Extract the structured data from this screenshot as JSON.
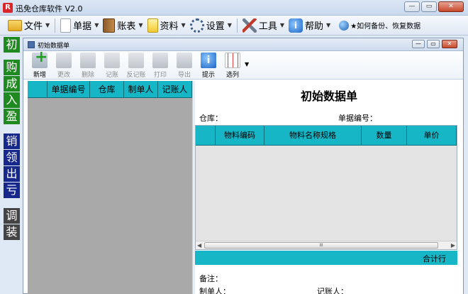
{
  "app": {
    "logo": "R",
    "title": "迅免仓库软件 V2.0"
  },
  "menu": {
    "file": "文件",
    "bill": "单据",
    "ledger": "账表",
    "info": "资料",
    "settings": "设置",
    "tools": "工具",
    "help": "帮助",
    "backup": "★如何备份、恢复数据"
  },
  "left_nav": [
    "初",
    "购",
    "成",
    "入",
    "盈",
    "销",
    "领",
    "出",
    "亏",
    "调",
    "装"
  ],
  "child": {
    "title": "初始数据单",
    "toolbar": {
      "new": "新增",
      "edit": "更改",
      "delete": "删除",
      "post": "记账",
      "unpost": "反记账",
      "print": "打印",
      "export": "导出",
      "tips": "提示",
      "columns": "选列"
    }
  },
  "list_grid": {
    "columns": [
      "单据编号",
      "仓库",
      "制单人",
      "记账人"
    ]
  },
  "form": {
    "title": "初始数据单",
    "warehouse_label": "仓库：",
    "bill_no_label": "单据编号：",
    "columns": [
      "物料编码",
      "物料名称规格",
      "数量",
      "单价"
    ],
    "scroll_mid": "III",
    "total_label": "合计行",
    "remark_label": "备注：",
    "maker_label": "制单人：",
    "poster_label": "记账人："
  },
  "colors": {
    "header_teal": "#17b6c7",
    "nav_green": "#1f8a1f",
    "nav_navy": "#17288c",
    "nav_gray": "#444444"
  }
}
